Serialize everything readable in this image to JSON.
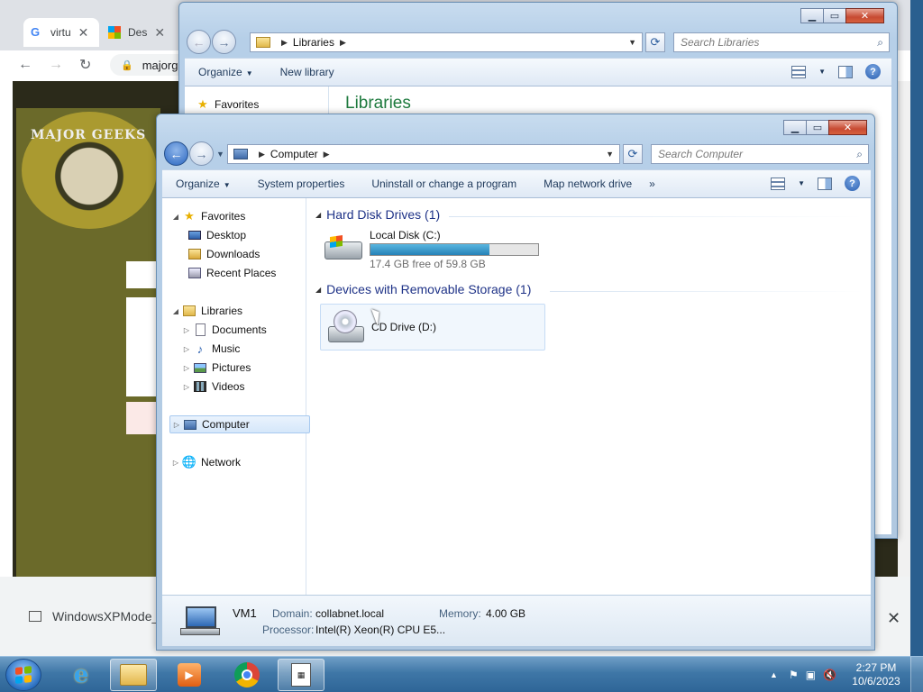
{
  "chrome": {
    "tabs": [
      {
        "label": "virtu",
        "icon": "google-icon"
      },
      {
        "label": "Des",
        "icon": "microsoft-icon"
      }
    ],
    "address": "majorg",
    "logo_text": "MAJOR GEEKS",
    "download": {
      "label": "WindowsXPMode_",
      "close": "✕"
    }
  },
  "win_back": {
    "breadcrumb": [
      "Libraries"
    ],
    "search_placeholder": "Search Libraries",
    "commands": [
      "Organize",
      "New library"
    ],
    "nav_favorites": "Favorites",
    "heading": "Libraries"
  },
  "win_front": {
    "breadcrumb": [
      "Computer"
    ],
    "search_placeholder": "Search Computer",
    "commands": [
      "Organize",
      "System properties",
      "Uninstall or change a program",
      "Map network drive",
      "»"
    ],
    "nav": {
      "favorites": "Favorites",
      "desktop": "Desktop",
      "downloads": "Downloads",
      "recent": "Recent Places",
      "libraries": "Libraries",
      "documents": "Documents",
      "music": "Music",
      "pictures": "Pictures",
      "videos": "Videos",
      "computer": "Computer",
      "network": "Network"
    },
    "groups": {
      "hdd": "Hard Disk Drives (1)",
      "removable": "Devices with Removable Storage (1)"
    },
    "drive_c": {
      "name": "Local Disk (C:)",
      "free": "17.4 GB free of 59.8 GB",
      "used_fraction": 0.709
    },
    "drive_d": {
      "name": "CD Drive (D:)"
    },
    "details": {
      "computer_name": "VM1",
      "domain_label": "Domain:",
      "domain_value": "collabnet.local",
      "memory_label": "Memory:",
      "memory_value": "4.00 GB",
      "processor_label": "Processor:",
      "processor_value": "Intel(R) Xeon(R) CPU E5..."
    }
  },
  "taskbar": {
    "time": "2:27 PM",
    "date": "10/6/2023",
    "tray_arrow": "▲"
  },
  "colors": {
    "accent": "#1e3287",
    "drive_fill": "#2682b7",
    "taskbar": "#3f77a7"
  }
}
